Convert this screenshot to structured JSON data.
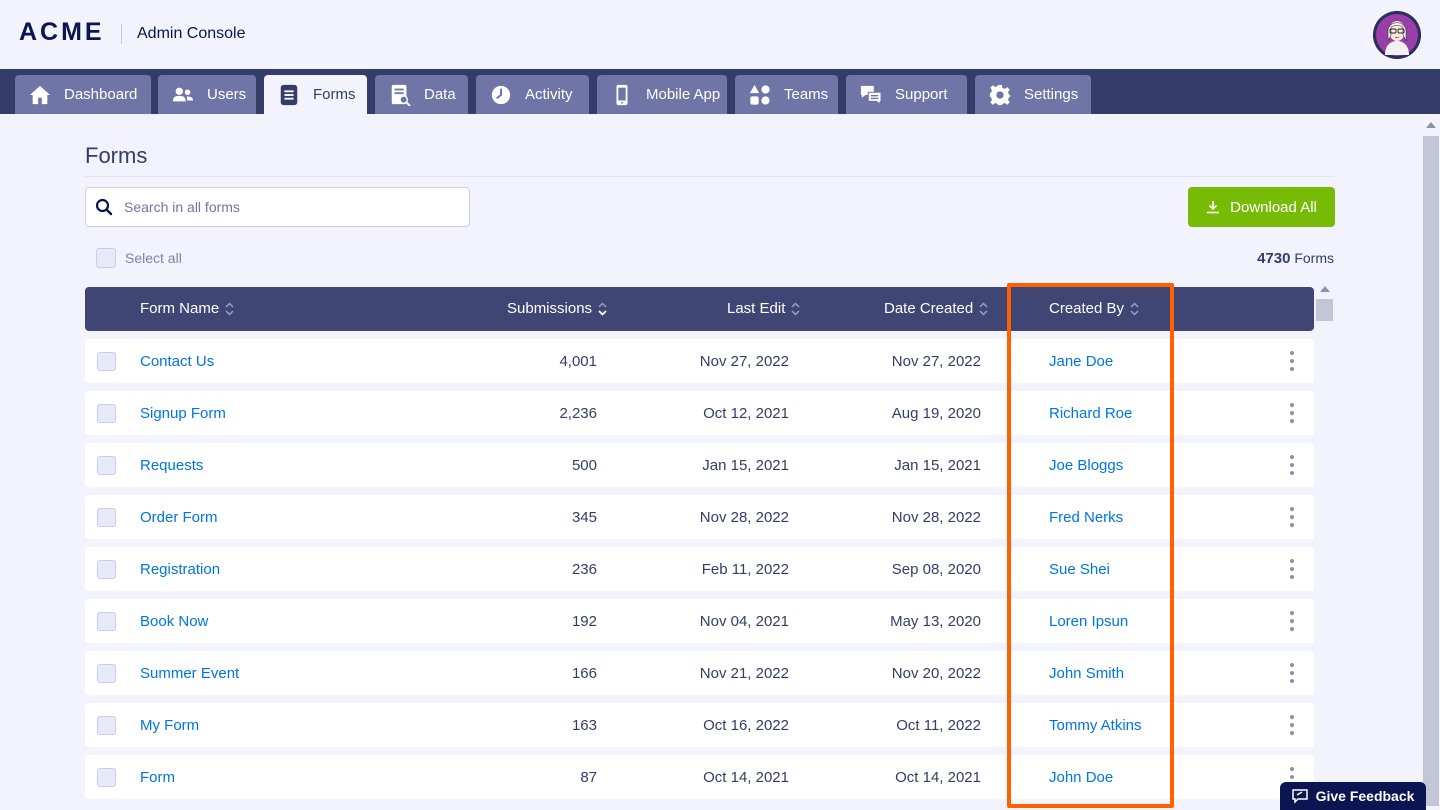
{
  "header": {
    "logo": "ACME",
    "app_title": "Admin Console"
  },
  "nav": {
    "tabs": [
      {
        "label": "Dashboard",
        "icon": "home-icon",
        "active": false
      },
      {
        "label": "Users",
        "icon": "users-icon",
        "active": false
      },
      {
        "label": "Forms",
        "icon": "forms-icon",
        "active": true
      },
      {
        "label": "Data",
        "icon": "data-icon",
        "active": false
      },
      {
        "label": "Activity",
        "icon": "clock-icon",
        "active": false
      },
      {
        "label": "Mobile App",
        "icon": "mobile-icon",
        "active": false
      },
      {
        "label": "Teams",
        "icon": "teams-icon",
        "active": false
      },
      {
        "label": "Support",
        "icon": "chat-icon",
        "active": false
      },
      {
        "label": "Settings",
        "icon": "gear-icon",
        "active": false
      }
    ]
  },
  "page": {
    "title": "Forms",
    "search_placeholder": "Search in all forms",
    "download_label": "Download All",
    "select_all_label": "Select all",
    "count_number": "4730",
    "count_label": "Forms"
  },
  "table": {
    "columns": [
      "Form Name",
      "Submissions",
      "Last Edit",
      "Date Created",
      "Created By"
    ],
    "rows": [
      {
        "name": "Contact Us",
        "submissions": "4,001",
        "last_edit": "Nov 27, 2022",
        "created": "Nov 27, 2022",
        "created_by": "Jane Doe"
      },
      {
        "name": "Signup Form",
        "submissions": "2,236",
        "last_edit": "Oct 12, 2021",
        "created": "Aug 19, 2020",
        "created_by": "Richard Roe"
      },
      {
        "name": "Requests",
        "submissions": "500",
        "last_edit": "Jan 15, 2021",
        "created": "Jan 15, 2021",
        "created_by": "Joe Bloggs"
      },
      {
        "name": "Order Form",
        "submissions": "345",
        "last_edit": "Nov 28, 2022",
        "created": "Nov 28, 2022",
        "created_by": "Fred Nerks"
      },
      {
        "name": "Registration",
        "submissions": "236",
        "last_edit": "Feb 11, 2022",
        "created": "Sep 08, 2020",
        "created_by": "Sue Shei"
      },
      {
        "name": "Book Now",
        "submissions": "192",
        "last_edit": "Nov 04, 2021",
        "created": "May 13, 2020",
        "created_by": "Loren Ipsun"
      },
      {
        "name": "Summer Event",
        "submissions": "166",
        "last_edit": "Nov 21, 2022",
        "created": "Nov 20, 2022",
        "created_by": "John Smith"
      },
      {
        "name": "My Form",
        "submissions": "163",
        "last_edit": "Oct 16, 2022",
        "created": "Oct 11, 2022",
        "created_by": "Tommy Atkins"
      },
      {
        "name": "Form",
        "submissions": "87",
        "last_edit": "Oct 14, 2021",
        "created": "Oct 14, 2021",
        "created_by": "John Doe"
      }
    ]
  },
  "feedback": {
    "label": "Give Feedback"
  },
  "colors": {
    "navy": "#343c6a",
    "accent_green": "#78bb07",
    "link_blue": "#0075e3",
    "highlight_orange": "#ff6100"
  }
}
